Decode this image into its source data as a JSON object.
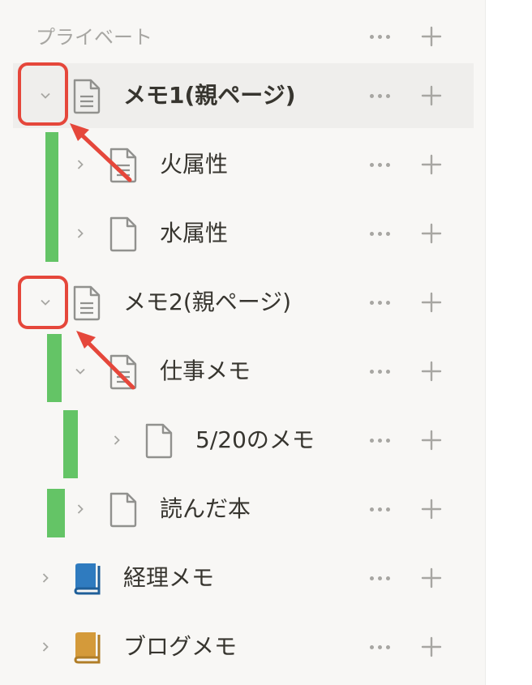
{
  "sidebar": {
    "section_title": "プライベート",
    "items": [
      {
        "label": "メモ1(親ページ)",
        "toggle": "expanded",
        "icon": "document-lines-icon"
      },
      {
        "label": "火属性",
        "toggle": "collapsed",
        "icon": "document-lines-icon"
      },
      {
        "label": "水属性",
        "toggle": "collapsed",
        "icon": "document-blank-icon"
      },
      {
        "label": "メモ2(親ページ)",
        "toggle": "expanded",
        "icon": "document-lines-icon"
      },
      {
        "label": "仕事メモ",
        "toggle": "expanded",
        "icon": "document-lines-icon"
      },
      {
        "label": "5/20のメモ",
        "toggle": "collapsed",
        "icon": "document-blank-icon"
      },
      {
        "label": "読んだ本",
        "toggle": "collapsed",
        "icon": "document-blank-icon"
      },
      {
        "label": "経理メモ",
        "toggle": "collapsed",
        "icon": "blue-notebook-icon"
      },
      {
        "label": "ブログメモ",
        "toggle": "collapsed",
        "icon": "orange-notebook-icon"
      }
    ]
  },
  "colors": {
    "highlight_row": "#efeeec",
    "indent_guide": "#64c466",
    "annotation": "#e5473b",
    "blue_notebook": "#2f7bbf",
    "orange_notebook": "#d49a3a"
  }
}
